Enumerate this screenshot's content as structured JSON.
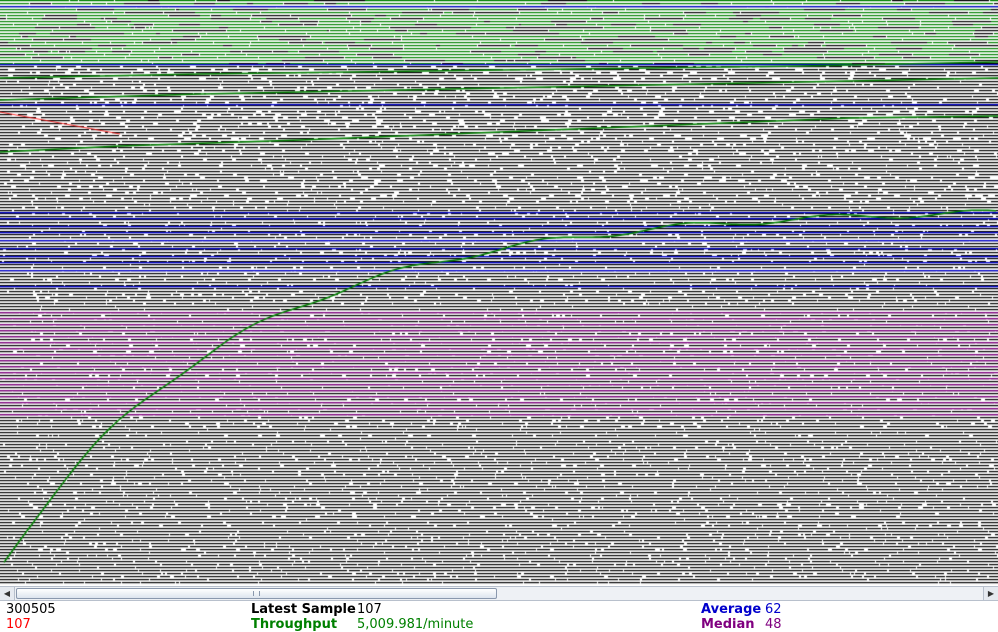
{
  "stats": {
    "samples": "300505",
    "deviation": "107",
    "latest_sample_label": "Latest Sample",
    "latest_sample_value": "107",
    "throughput_label": "Throughput",
    "throughput_value": "5,009.981/minute",
    "average_label": "Average",
    "average_value": "62",
    "median_label": "Median",
    "median_value": "48"
  },
  "colors": {
    "data": "#000000",
    "average": "#0000cc",
    "median": "#800080",
    "deviation": "#ff0000",
    "throughput": "#008000"
  },
  "scrollbar": {
    "left_arrow_icon": "arrow-left-icon",
    "right_arrow_icon": "arrow-right-icon",
    "thumb_fraction": 0.5
  }
}
